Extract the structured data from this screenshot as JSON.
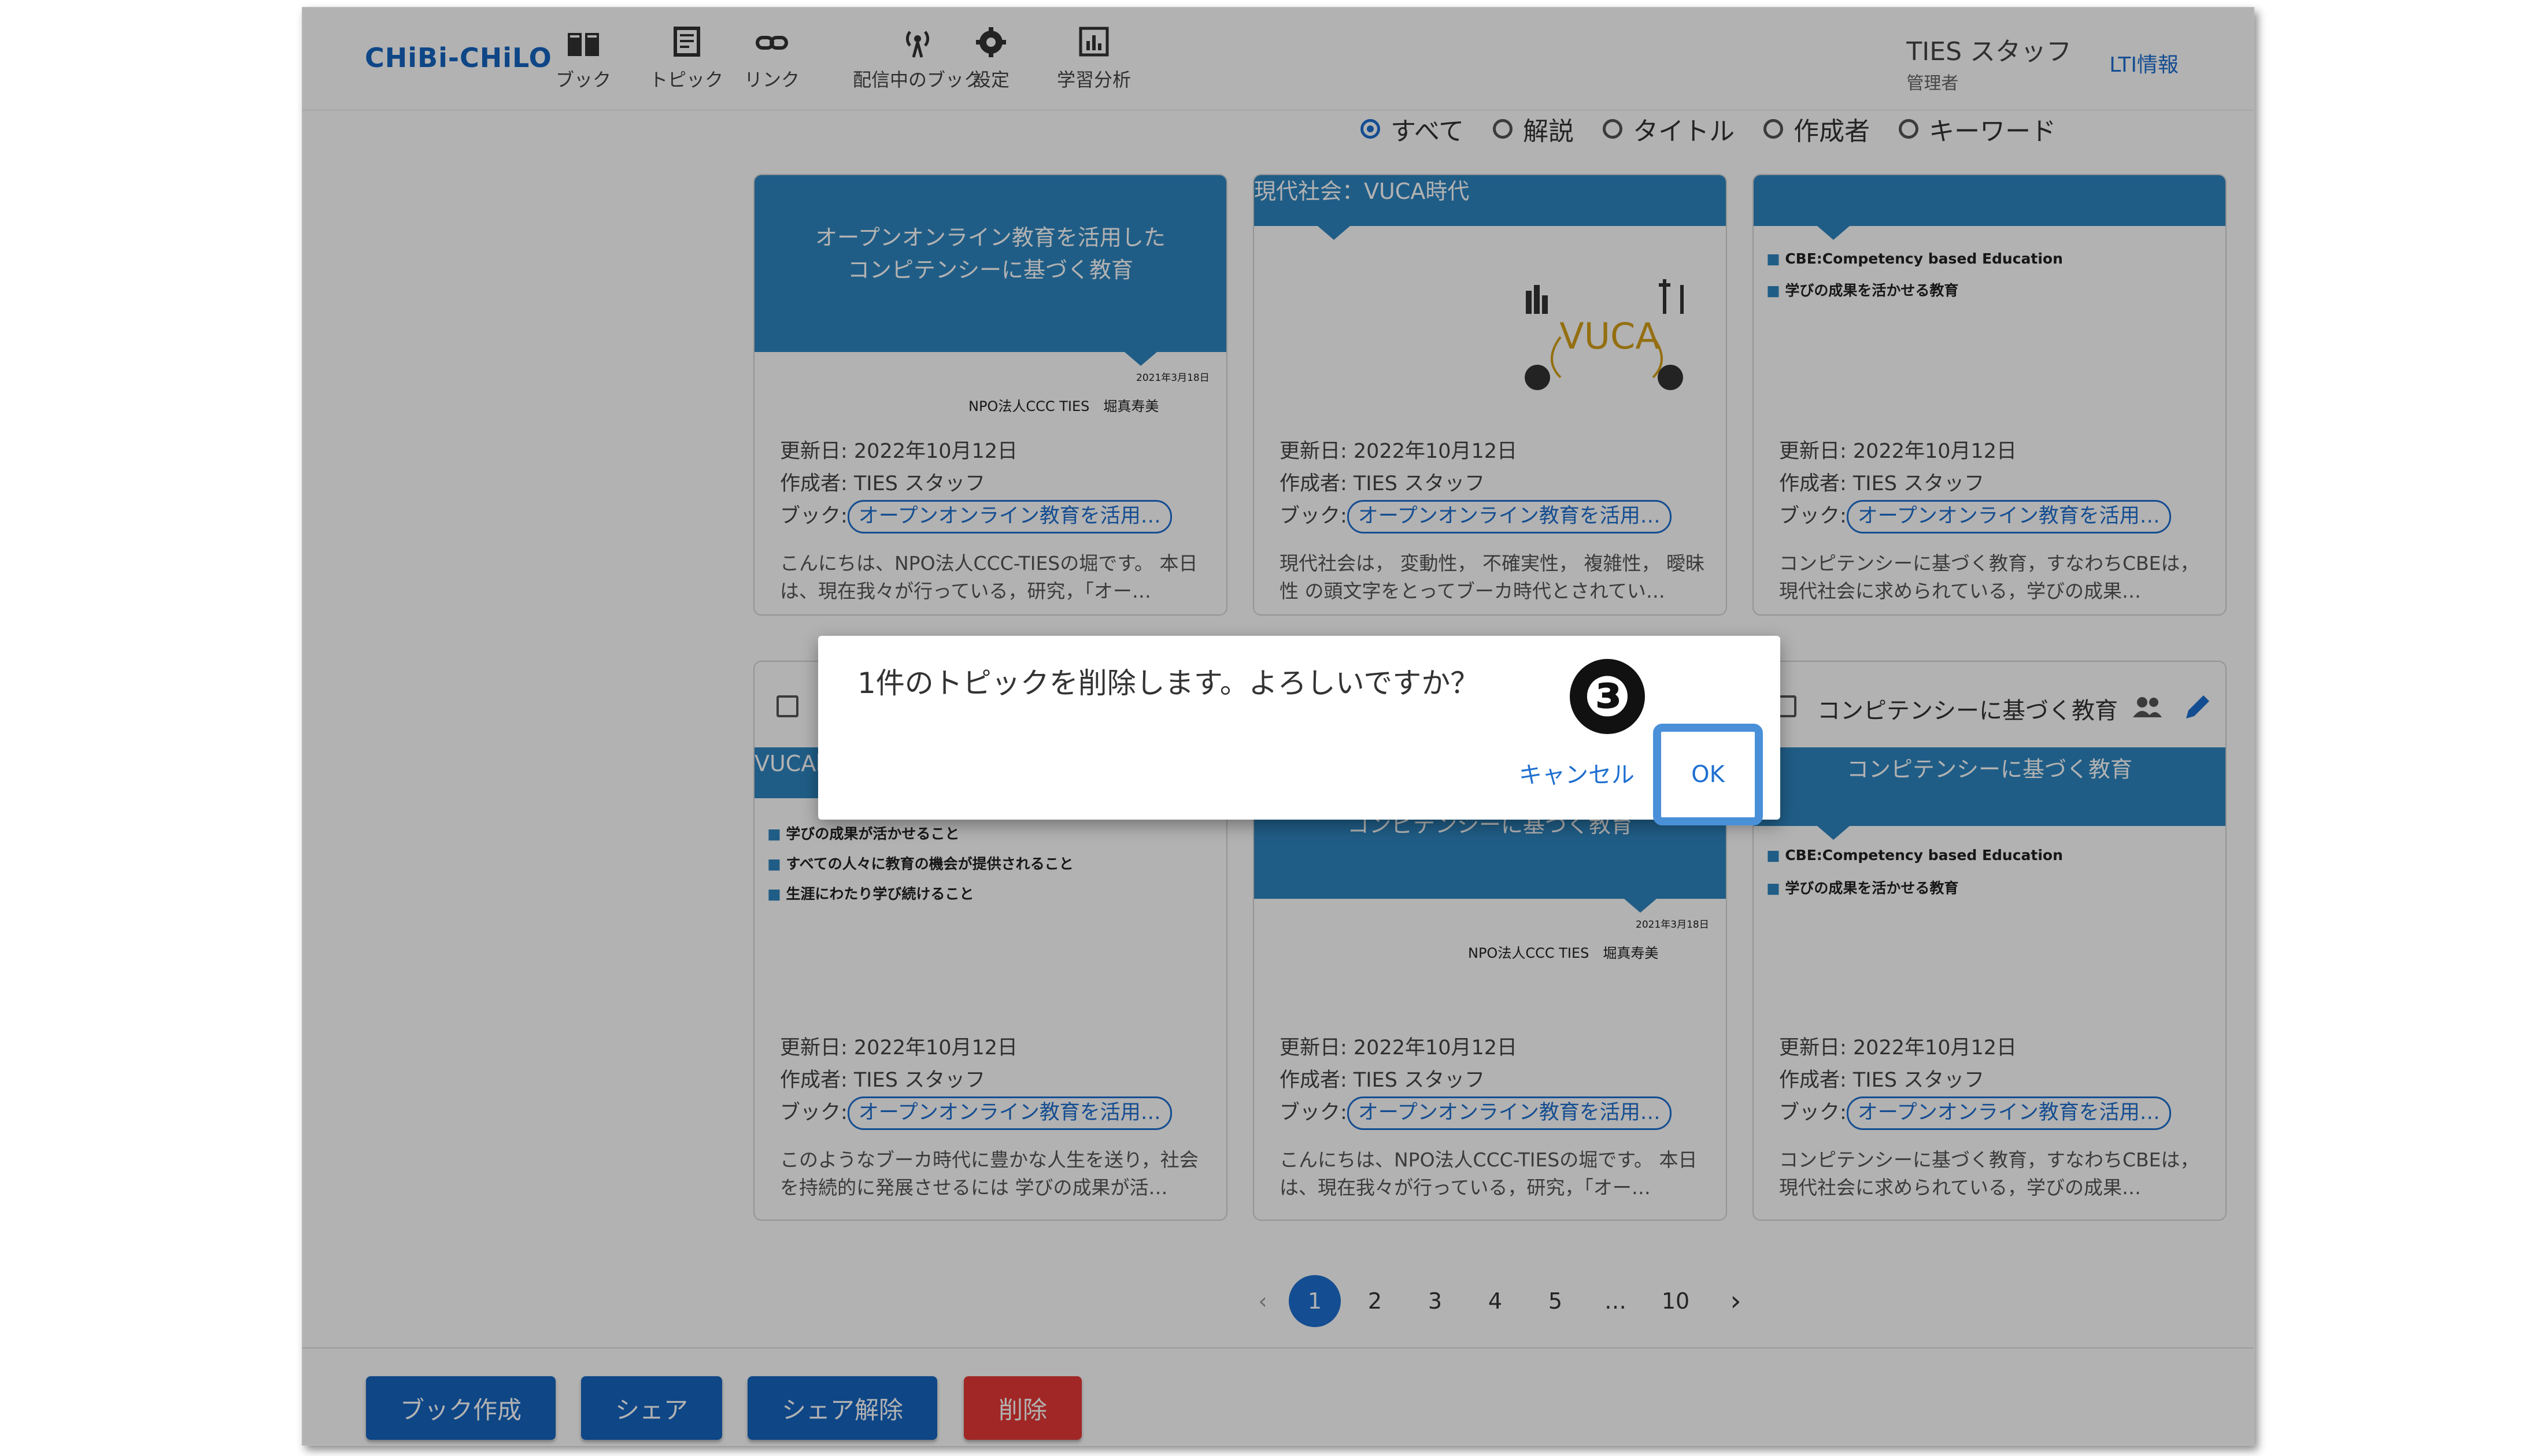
{
  "app": {
    "logo": "CHiBi-CHiLO"
  },
  "nav": [
    {
      "label": "ブック",
      "icon": "book-icon"
    },
    {
      "label": "トピック",
      "icon": "topic-icon"
    },
    {
      "label": "リンク",
      "icon": "link-icon"
    },
    {
      "label": "配信中のブック",
      "icon": "broadcast-icon"
    },
    {
      "label": "設定",
      "icon": "gear-icon"
    },
    {
      "label": "学習分析",
      "icon": "analytics-icon"
    }
  ],
  "user": {
    "name": "TIES スタッフ",
    "role": "管理者",
    "lti": "LTI情報"
  },
  "search": {
    "options": [
      "すべて",
      "解説",
      "タイトル",
      "作成者",
      "キーワード"
    ],
    "selected": "すべて"
  },
  "cards": [
    {
      "slide": "open",
      "updated": "更新日: 2022年10月12日",
      "author": "作成者: TIES スタッフ",
      "book_label": "ブック:",
      "book": "オープンオンライン教育を活用…",
      "desc": "こんにちは、NPO法人CCC-TIESの堀です。 本日は、現在我々が行っている，研究，「オー…"
    },
    {
      "slide": "vuca",
      "updated": "更新日: 2022年10月12日",
      "author": "作成者: TIES スタッフ",
      "book_label": "ブック:",
      "book": "オープンオンライン教育を活用…",
      "desc": "現代社会は， 変動性， 不確実性， 複雑性， 曖昧性 の頭文字をとってブーカ時代とされてい…"
    },
    {
      "slide": "cbe",
      "updated": "更新日: 2022年10月12日",
      "author": "作成者: TIES スタッフ",
      "book_label": "ブック:",
      "book": "オープンオンライン教育を活用…",
      "desc": "コンピテンシーに基づく教育，すなわちCBEは，現代社会に求められている，学びの成果…"
    },
    {
      "slide": "vuca2",
      "updated": "更新日: 2022年10月12日",
      "author": "作成者: TIES スタッフ",
      "book_label": "ブック:",
      "book": "オープンオンライン教育を活用…",
      "desc": "このようなブーカ時代に豊かな人生を送り，社会を持続的に発展させるには 学びの成果が活…"
    },
    {
      "slide": "open",
      "updated": "更新日: 2022年10月12日",
      "author": "作成者: TIES スタッフ",
      "book_label": "ブック:",
      "book": "オープンオンライン教育を活用…",
      "desc": "こんにちは、NPO法人CCC-TIESの堀です。 本日は、現在我々が行っている，研究，「オー…"
    },
    {
      "slide": "cbe",
      "title": "コンピテンシーに基づく教育",
      "updated": "更新日: 2022年10月12日",
      "author": "作成者: TIES スタッフ",
      "book_label": "ブック:",
      "book": "オープンオンライン教育を活用…",
      "desc": "コンピテンシーに基づく教育，すなわちCBEは，現代社会に求められている，学びの成果…"
    }
  ],
  "slides": {
    "open_title_1": "オープンオンライン教育を活用した",
    "open_title_2": "コンピテンシーに基づく教育",
    "open_date": "2021年3月18日",
    "open_author": "NPO法人CCC TIES　堀真寿美",
    "vuca_header": "現代社会：VUCA時代",
    "vuca_word": "VUCA",
    "cbe_header_top": "コンピテンシーに基づく教育",
    "cbe_bullet_1": "CBE:Competency based Education",
    "cbe_bullet_2": "学びの成果を活かせる教育",
    "vuca2_header": "VUCA時",
    "vuca2_bullet_1": "学びの成果が活かせること",
    "vuca2_bullet_2": "すべての人々に教育の機会が提供されること",
    "vuca2_bullet_3": "生涯にわたり学び続けること"
  },
  "pagination": {
    "prev": "‹",
    "pages": [
      "1",
      "2",
      "3",
      "4",
      "5",
      "…",
      "10"
    ],
    "current": "1",
    "next": "›"
  },
  "footer": {
    "create_book": "ブック作成",
    "share": "シェア",
    "unshare": "シェア解除",
    "delete": "削除"
  },
  "dialog": {
    "message": "1件のトピックを削除します。よろしいですか？",
    "cancel": "キャンセル",
    "ok": "OK",
    "step": "❸"
  },
  "colors": {
    "primary": "#1565c0",
    "danger": "#e53935",
    "slide_blue": "#2e86c1",
    "highlight": "#4a90d9"
  }
}
